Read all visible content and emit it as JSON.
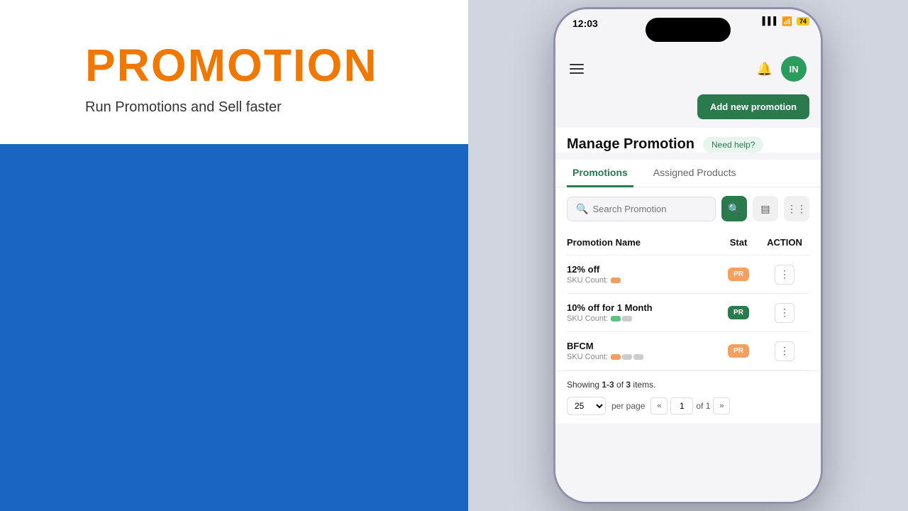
{
  "left": {
    "title": "PROMOTION",
    "subtitle": "Run Promotions and Sell faster"
  },
  "status_bar": {
    "time": "12:03",
    "battery": "74"
  },
  "header": {
    "user_initials": "IN"
  },
  "page": {
    "add_btn_label": "Add new promotion",
    "manage_title": "Manage Promotion",
    "need_help_label": "Need help?"
  },
  "tabs": [
    {
      "label": "Promotions",
      "active": true
    },
    {
      "label": "Assigned Products",
      "active": false
    }
  ],
  "search": {
    "placeholder": "Search Promotion"
  },
  "table": {
    "col_name": "Promotion Name",
    "col_status": "Stat",
    "col_action": "ACTION",
    "rows": [
      {
        "name": "12% off",
        "sku_label": "SKU Count:",
        "sku_count": "",
        "status": "PR",
        "status_type": "orange"
      },
      {
        "name": "10% off for 1 Month",
        "sku_label": "SKU Count:",
        "sku_count": "",
        "status": "PR",
        "status_type": "green"
      },
      {
        "name": "BFCM",
        "sku_label": "SKU Count:",
        "sku_count": "",
        "status": "PR",
        "status_type": "orange"
      }
    ]
  },
  "pagination": {
    "showing_text": "Showing ",
    "showing_range": "1-3",
    "showing_of": " of ",
    "showing_total": "3",
    "showing_suffix": " items.",
    "per_page": "25",
    "per_page_label": "per page",
    "page_current": "1",
    "page_of": "of 1"
  }
}
